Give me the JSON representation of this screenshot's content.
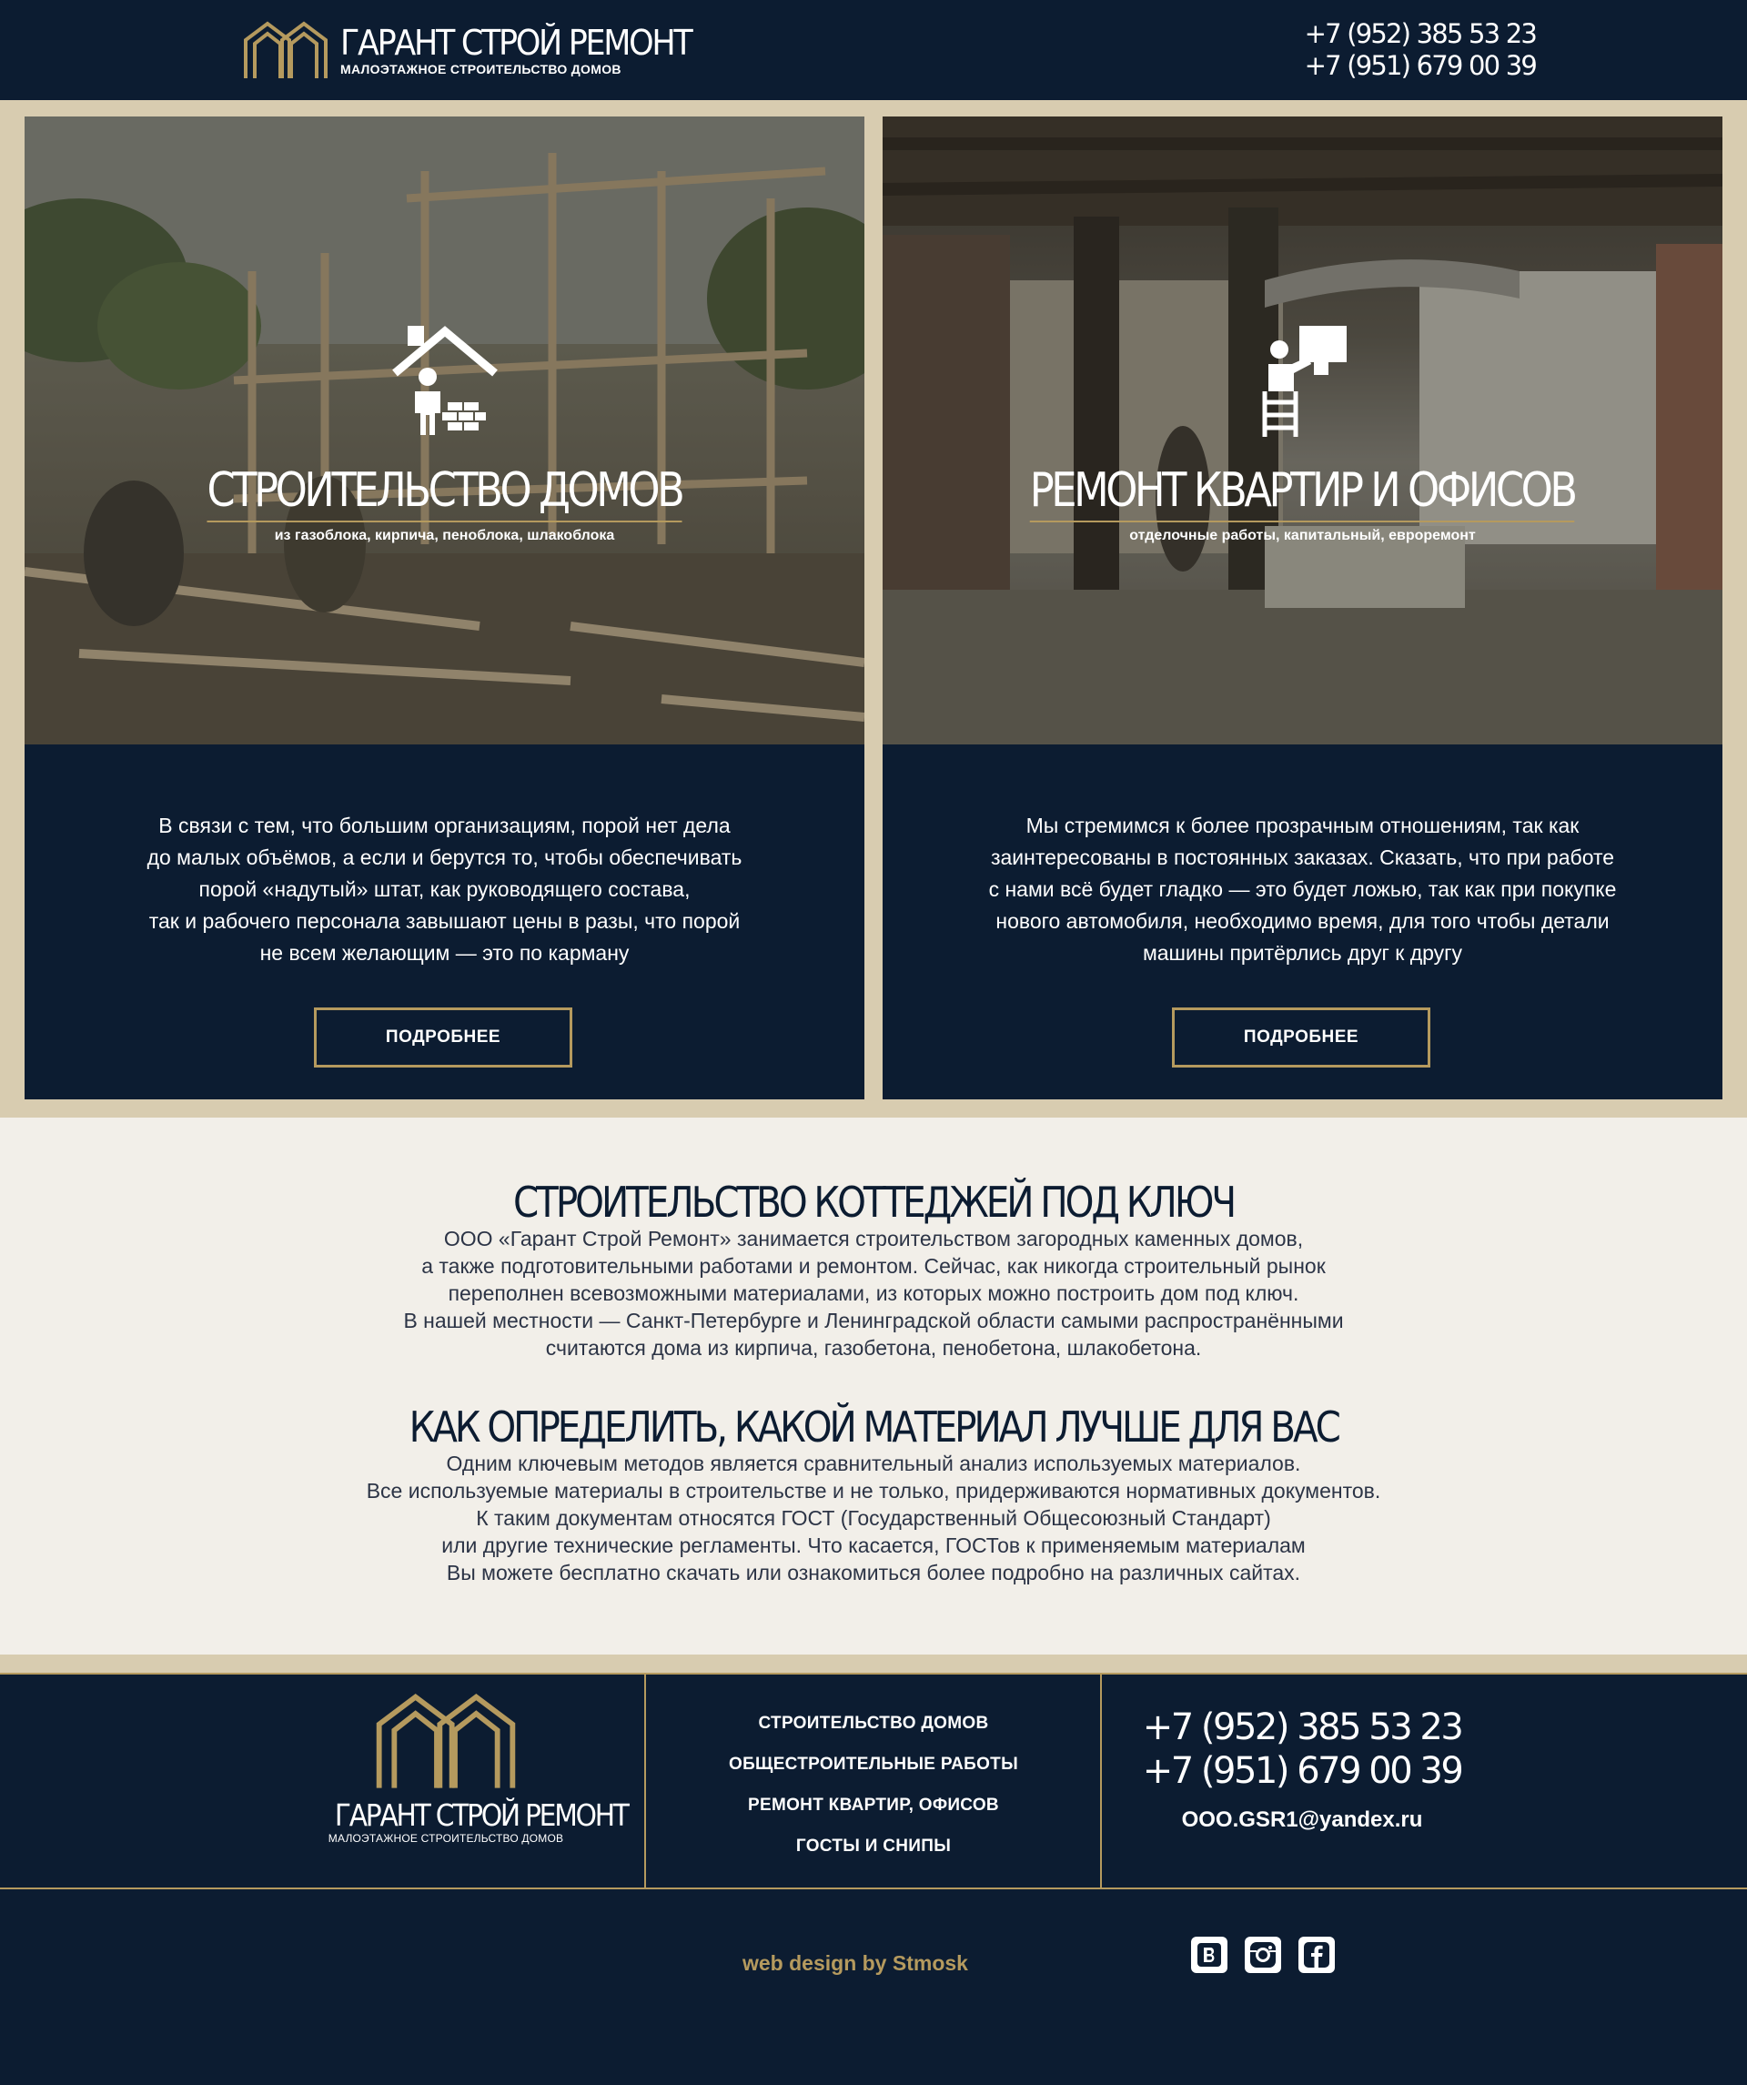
{
  "header": {
    "logo_title": "ГАРАНТ СТРОЙ РЕМОНТ",
    "logo_subtitle": "МАЛОЭТАЖНОЕ СТРОИТЕЛЬСТВО ДОМОВ",
    "phones": [
      "+7 (952) 385 53 23",
      "+7 (951) 679 00 39"
    ]
  },
  "cards": [
    {
      "title": "СТРОИТЕЛЬСТВО ДОМОВ",
      "subtitle": "из газоблока, кирпича, пеноблока, шлакоблока",
      "icon": "builder-house-icon",
      "text_lines": [
        "В связи с тем, что большим организациям, порой нет дела",
        "до малых объёмов, а если и берутся то, чтобы обеспечивать",
        "порой «надутый» штат, как руководящего состава,",
        "так и рабочего персонала завышают цены в разы, что порой",
        "не всем желающим — это по карману"
      ],
      "button": "ПОДРОБНЕЕ"
    },
    {
      "title": "РЕМОНТ КВАРТИР И ОФИСОВ",
      "subtitle": "отделочные работы, капитальный, евроремонт",
      "icon": "painter-ladder-icon",
      "text_lines": [
        "Мы стремимся к более прозрачным отношениям, так как",
        "заинтересованы в постоянных заказах. Сказать, что при работе",
        "с нами всё будет гладко — это будет ложью, так как при покупке",
        "нового автомобиля, необходимо время, для того чтобы детали",
        "машины притёрлись друг к другу"
      ],
      "button": "ПОДРОБНЕЕ"
    }
  ],
  "info": {
    "heading1": "СТРОИТЕЛЬСТВО КОТТЕДЖЕЙ ПОД КЛЮЧ",
    "paragraph1": [
      "ООО «Гарант Строй Ремонт» занимается строительством загородных каменных домов,",
      "а также подготовительными работами и ремонтом. Сейчас, как никогда строительный рынок",
      "переполнен всевозможными материалами, из которых можно построить дом под ключ.",
      "В нашей местности — Санкт-Петербурге и Ленинградской области самыми распространёнными",
      "считаются дома из кирпича, газобетона, пенобетона, шлакобетона."
    ],
    "heading2": "КАК ОПРЕДЕЛИТЬ, КАКОЙ МАТЕРИАЛ ЛУЧШЕ ДЛЯ ВАС",
    "paragraph2": [
      "Одним ключевым методов является сравнительный анализ используемых материалов.",
      "Все используемые материалы в строительстве и не только, придерживаются нормативных документов.",
      "К таким документам относятся ГОСТ (Государственный Общесоюзный Стандарт)",
      "или другие технические регламенты. Что касается, ГОСТов к применяемым материалам",
      "Вы можете бесплатно скачать или ознакомиться более подробно на различных сайтах."
    ]
  },
  "footer": {
    "logo_title": "ГАРАНТ СТРОЙ РЕМОНТ",
    "logo_subtitle": "МАЛОЭТАЖНОЕ СТРОИТЕЛЬСТВО ДОМОВ",
    "menu": [
      "СТРОИТЕЛЬСТВО ДОМОВ",
      "ОБЩЕСТРОИТЕЛЬНЫЕ РАБОТЫ",
      "РЕМОНТ КВАРТИР, ОФИСОВ",
      "ГОСТЫ И СНИПЫ"
    ],
    "phones": [
      "+7 (952) 385 53 23",
      "+7 (951) 679 00 39"
    ],
    "email": "OOO.GSR1@yandex.ru",
    "credit_prefix": "web design by ",
    "credit_name": "Stmosk",
    "social": [
      "vk-icon",
      "instagram-icon",
      "facebook-icon"
    ]
  },
  "colors": {
    "navy": "#0c1c31",
    "gold": "#b59a5e",
    "beige": "#d8ccb0",
    "light": "#f2efe9"
  }
}
